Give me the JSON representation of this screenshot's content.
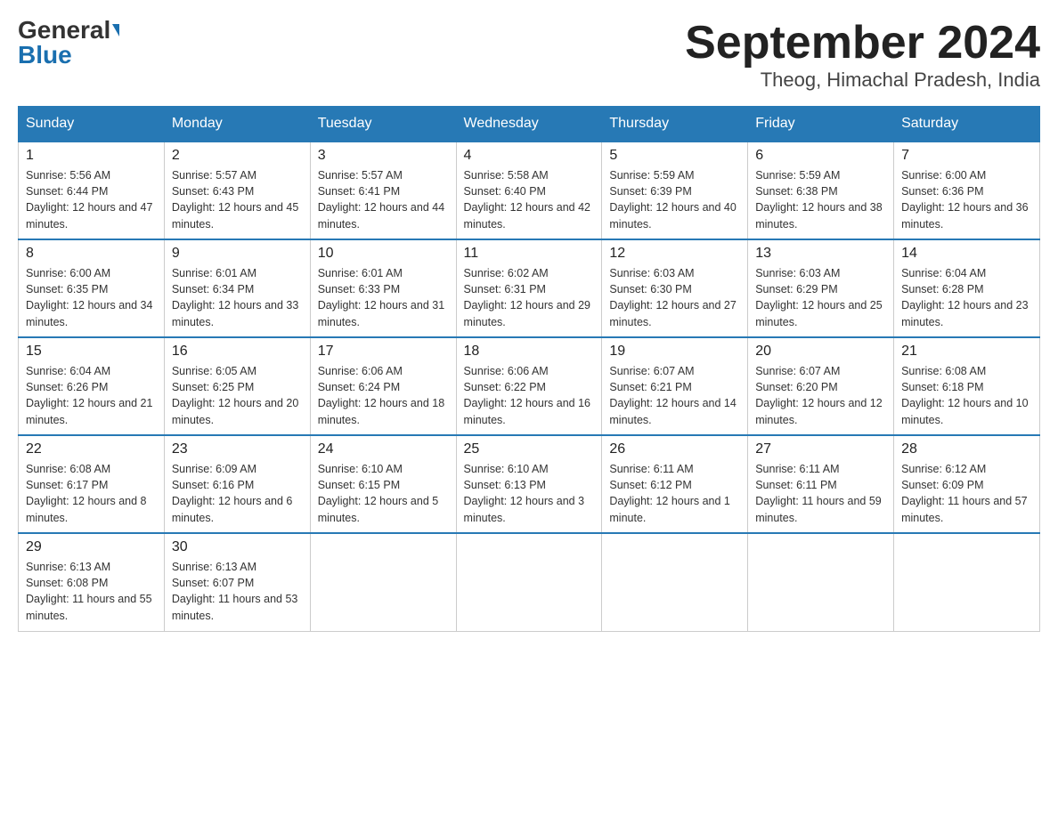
{
  "logo": {
    "general": "General",
    "blue": "Blue"
  },
  "title": {
    "month_year": "September 2024",
    "location": "Theog, Himachal Pradesh, India"
  },
  "headers": [
    "Sunday",
    "Monday",
    "Tuesday",
    "Wednesday",
    "Thursday",
    "Friday",
    "Saturday"
  ],
  "weeks": [
    [
      {
        "day": "1",
        "sunrise": "5:56 AM",
        "sunset": "6:44 PM",
        "daylight": "12 hours and 47 minutes."
      },
      {
        "day": "2",
        "sunrise": "5:57 AM",
        "sunset": "6:43 PM",
        "daylight": "12 hours and 45 minutes."
      },
      {
        "day": "3",
        "sunrise": "5:57 AM",
        "sunset": "6:41 PM",
        "daylight": "12 hours and 44 minutes."
      },
      {
        "day": "4",
        "sunrise": "5:58 AM",
        "sunset": "6:40 PM",
        "daylight": "12 hours and 42 minutes."
      },
      {
        "day": "5",
        "sunrise": "5:59 AM",
        "sunset": "6:39 PM",
        "daylight": "12 hours and 40 minutes."
      },
      {
        "day": "6",
        "sunrise": "5:59 AM",
        "sunset": "6:38 PM",
        "daylight": "12 hours and 38 minutes."
      },
      {
        "day": "7",
        "sunrise": "6:00 AM",
        "sunset": "6:36 PM",
        "daylight": "12 hours and 36 minutes."
      }
    ],
    [
      {
        "day": "8",
        "sunrise": "6:00 AM",
        "sunset": "6:35 PM",
        "daylight": "12 hours and 34 minutes."
      },
      {
        "day": "9",
        "sunrise": "6:01 AM",
        "sunset": "6:34 PM",
        "daylight": "12 hours and 33 minutes."
      },
      {
        "day": "10",
        "sunrise": "6:01 AM",
        "sunset": "6:33 PM",
        "daylight": "12 hours and 31 minutes."
      },
      {
        "day": "11",
        "sunrise": "6:02 AM",
        "sunset": "6:31 PM",
        "daylight": "12 hours and 29 minutes."
      },
      {
        "day": "12",
        "sunrise": "6:03 AM",
        "sunset": "6:30 PM",
        "daylight": "12 hours and 27 minutes."
      },
      {
        "day": "13",
        "sunrise": "6:03 AM",
        "sunset": "6:29 PM",
        "daylight": "12 hours and 25 minutes."
      },
      {
        "day": "14",
        "sunrise": "6:04 AM",
        "sunset": "6:28 PM",
        "daylight": "12 hours and 23 minutes."
      }
    ],
    [
      {
        "day": "15",
        "sunrise": "6:04 AM",
        "sunset": "6:26 PM",
        "daylight": "12 hours and 21 minutes."
      },
      {
        "day": "16",
        "sunrise": "6:05 AM",
        "sunset": "6:25 PM",
        "daylight": "12 hours and 20 minutes."
      },
      {
        "day": "17",
        "sunrise": "6:06 AM",
        "sunset": "6:24 PM",
        "daylight": "12 hours and 18 minutes."
      },
      {
        "day": "18",
        "sunrise": "6:06 AM",
        "sunset": "6:22 PM",
        "daylight": "12 hours and 16 minutes."
      },
      {
        "day": "19",
        "sunrise": "6:07 AM",
        "sunset": "6:21 PM",
        "daylight": "12 hours and 14 minutes."
      },
      {
        "day": "20",
        "sunrise": "6:07 AM",
        "sunset": "6:20 PM",
        "daylight": "12 hours and 12 minutes."
      },
      {
        "day": "21",
        "sunrise": "6:08 AM",
        "sunset": "6:18 PM",
        "daylight": "12 hours and 10 minutes."
      }
    ],
    [
      {
        "day": "22",
        "sunrise": "6:08 AM",
        "sunset": "6:17 PM",
        "daylight": "12 hours and 8 minutes."
      },
      {
        "day": "23",
        "sunrise": "6:09 AM",
        "sunset": "6:16 PM",
        "daylight": "12 hours and 6 minutes."
      },
      {
        "day": "24",
        "sunrise": "6:10 AM",
        "sunset": "6:15 PM",
        "daylight": "12 hours and 5 minutes."
      },
      {
        "day": "25",
        "sunrise": "6:10 AM",
        "sunset": "6:13 PM",
        "daylight": "12 hours and 3 minutes."
      },
      {
        "day": "26",
        "sunrise": "6:11 AM",
        "sunset": "6:12 PM",
        "daylight": "12 hours and 1 minute."
      },
      {
        "day": "27",
        "sunrise": "6:11 AM",
        "sunset": "6:11 PM",
        "daylight": "11 hours and 59 minutes."
      },
      {
        "day": "28",
        "sunrise": "6:12 AM",
        "sunset": "6:09 PM",
        "daylight": "11 hours and 57 minutes."
      }
    ],
    [
      {
        "day": "29",
        "sunrise": "6:13 AM",
        "sunset": "6:08 PM",
        "daylight": "11 hours and 55 minutes."
      },
      {
        "day": "30",
        "sunrise": "6:13 AM",
        "sunset": "6:07 PM",
        "daylight": "11 hours and 53 minutes."
      },
      null,
      null,
      null,
      null,
      null
    ]
  ]
}
